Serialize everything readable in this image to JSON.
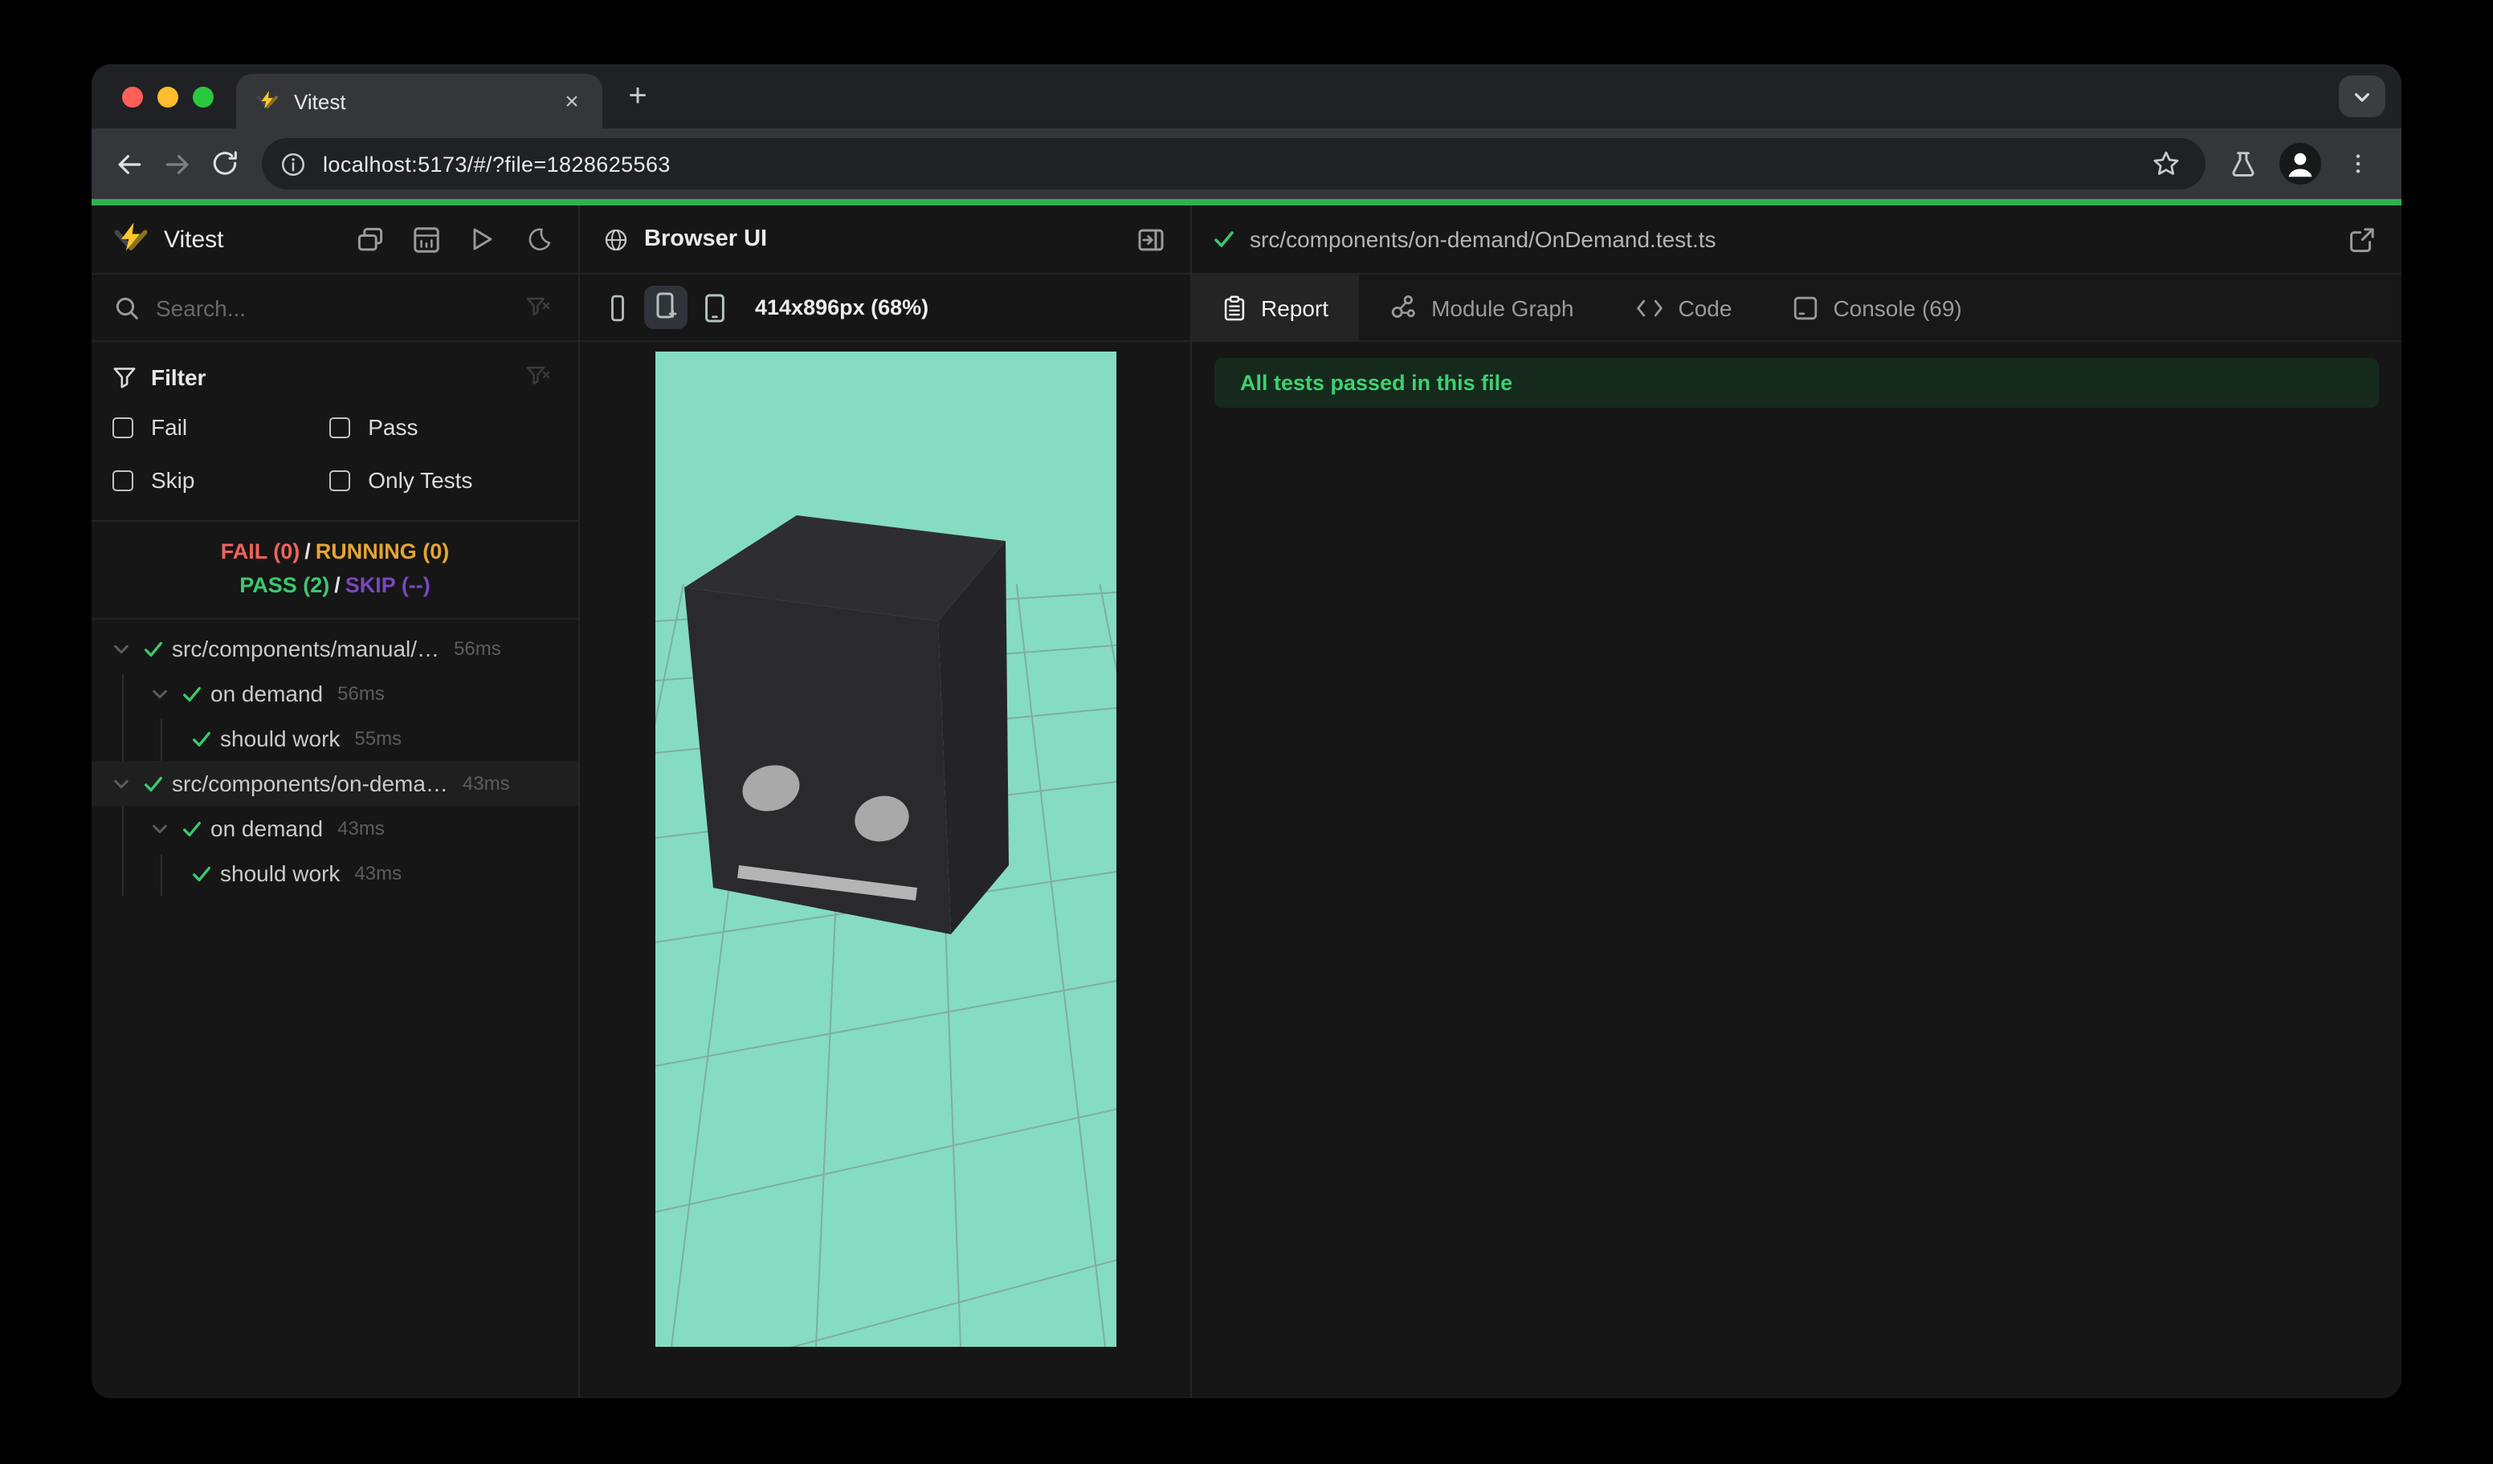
{
  "browser_chrome": {
    "tab_title": "Vitest",
    "url": "localhost:5173/#/?file=1828625563"
  },
  "vitest": {
    "brand": "Vitest",
    "search": {
      "placeholder": "Search..."
    },
    "filter": {
      "title": "Filter",
      "options": [
        "Fail",
        "Pass",
        "Skip",
        "Only Tests"
      ]
    },
    "status": {
      "fail": "FAIL (0)",
      "running": "RUNNING (0)",
      "pass": "PASS (2)",
      "skip": "SKIP (--)",
      "separator": "/"
    },
    "tree": [
      {
        "label": "src/components/manual/…",
        "time": "56ms",
        "depth": 0,
        "state": "pass"
      },
      {
        "label": "on demand",
        "time": "56ms",
        "depth": 1,
        "state": "pass"
      },
      {
        "label": "should work",
        "time": "55ms",
        "depth": 2,
        "state": "pass"
      },
      {
        "label": "src/components/on-dema…",
        "time": "43ms",
        "depth": 0,
        "state": "pass",
        "selected": true
      },
      {
        "label": "on demand",
        "time": "43ms",
        "depth": 1,
        "state": "pass"
      },
      {
        "label": "should work",
        "time": "43ms",
        "depth": 2,
        "state": "pass"
      }
    ]
  },
  "browser_panel": {
    "title": "Browser UI",
    "viewport_label": "414x896px (68%)"
  },
  "report_panel": {
    "file": "src/components/on-demand/OnDemand.test.ts",
    "tabs": [
      {
        "label": "Report",
        "active": true
      },
      {
        "label": "Module Graph",
        "active": false
      },
      {
        "label": "Code",
        "active": false
      },
      {
        "label": "Console (69)",
        "active": false
      }
    ],
    "banner": "All tests passed in this file"
  },
  "colors": {
    "pass_green": "#3cc86e",
    "fail_red": "#f0635a",
    "running_yellow": "#e6a532",
    "skip_purple": "#7a46c0",
    "mint_background": "#85dcc1",
    "progress_green": "#2eb24e"
  }
}
